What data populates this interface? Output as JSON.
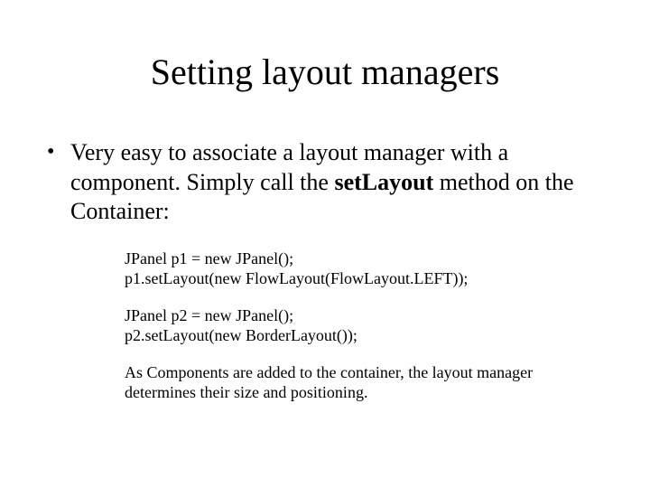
{
  "title": "Setting layout managers",
  "bullet": {
    "pre": "Very easy to associate a layout manager with a component. Simply call the ",
    "bold": "setLayout",
    "post": " method on the Container:"
  },
  "code": {
    "l1": "JPanel p1 = new JPanel();",
    "l2": "p1.setLayout(new FlowLayout(FlowLayout.LEFT));",
    "l3": "JPanel p2 = new JPanel();",
    "l4": "p2.setLayout(new BorderLayout());",
    "note": "As Components are added to the container, the layout manager determines their size and positioning."
  }
}
